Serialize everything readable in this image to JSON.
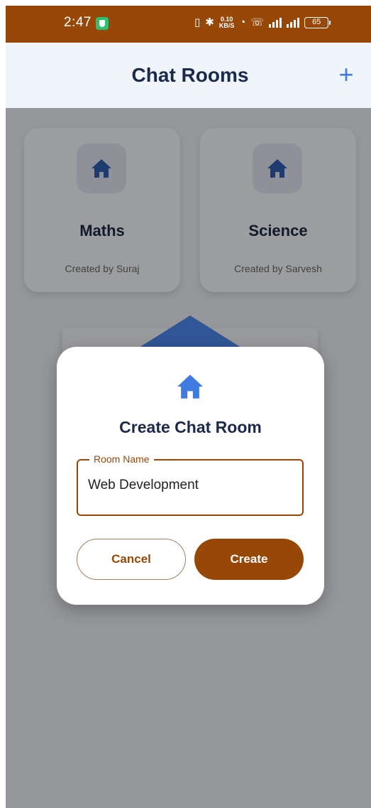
{
  "status_bar": {
    "time": "2:47",
    "speed_top": "0.10",
    "speed_bottom": "KB/S",
    "battery": "65"
  },
  "app_bar": {
    "title": "Chat Rooms",
    "add_label": "+"
  },
  "rooms": [
    {
      "name": "Maths",
      "creator": "Created by Suraj"
    },
    {
      "name": "Science",
      "creator": "Created by Sarvesh"
    }
  ],
  "dialog": {
    "title": "Create Chat Room",
    "field_label": "Room Name",
    "field_value": "Web Development",
    "cancel_label": "Cancel",
    "create_label": "Create"
  },
  "colors": {
    "brand": "#974807",
    "accent": "#3f7be0",
    "title_text": "#1b2a4a"
  },
  "icons": {
    "room_icon": "home-icon",
    "add_icon": "plus-icon"
  }
}
